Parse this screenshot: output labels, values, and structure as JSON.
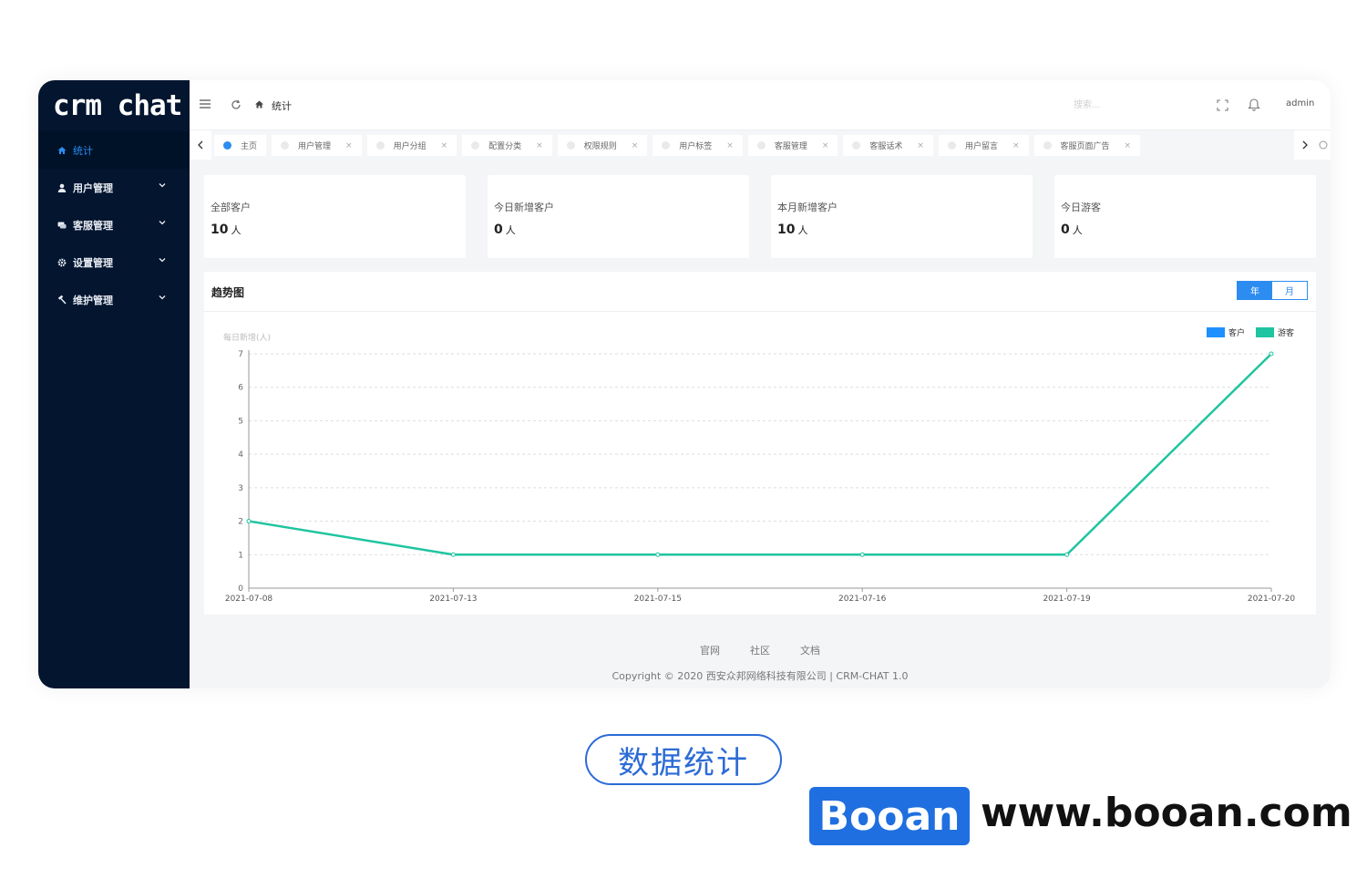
{
  "app": {
    "logo": "crm chat"
  },
  "sidebar": {
    "items": [
      {
        "label": "统计",
        "icon": "home-icon",
        "active": true
      },
      {
        "label": "用户管理",
        "icon": "user-icon"
      },
      {
        "label": "客服管理",
        "icon": "chat-icon"
      },
      {
        "label": "设置管理",
        "icon": "gear-icon"
      },
      {
        "label": "维护管理",
        "icon": "hammer-icon"
      }
    ]
  },
  "header": {
    "breadcrumb": "统计",
    "search_placeholder": "搜索...",
    "user": "admin"
  },
  "tabs": [
    {
      "label": "主页",
      "active": true
    },
    {
      "label": "用户管理"
    },
    {
      "label": "用户分组"
    },
    {
      "label": "配置分类"
    },
    {
      "label": "权限规则"
    },
    {
      "label": "用户标签"
    },
    {
      "label": "客服管理"
    },
    {
      "label": "客服话术"
    },
    {
      "label": "用户留言"
    },
    {
      "label": "客服页面广告"
    }
  ],
  "stats": [
    {
      "label": "全部客户",
      "value": "10",
      "unit": "人"
    },
    {
      "label": "今日新增客户",
      "value": "0",
      "unit": "人"
    },
    {
      "label": "本月新增客户",
      "value": "10",
      "unit": "人"
    },
    {
      "label": "今日游客",
      "value": "0",
      "unit": "人"
    }
  ],
  "trend": {
    "title": "趋势图",
    "toggle": {
      "year": "年",
      "month": "月",
      "selected": "year"
    }
  },
  "chart_data": {
    "type": "line",
    "ylabel": "每日新增(人)",
    "ylim": [
      0,
      7
    ],
    "yticks": [
      "0",
      "1",
      "2",
      "3",
      "4",
      "5",
      "6",
      "7"
    ],
    "x": [
      "2021-07-08",
      "2021-07-13",
      "2021-07-15",
      "2021-07-16",
      "2021-07-19",
      "2021-07-20"
    ],
    "legend_position": "top-right",
    "grid": true,
    "series": [
      {
        "name": "客户",
        "color": "#1e90ff",
        "values": []
      },
      {
        "name": "游客",
        "color": "#1fc4a0",
        "values": [
          2,
          1,
          1,
          1,
          1,
          7
        ]
      }
    ]
  },
  "footer": {
    "links": [
      "官网",
      "社区",
      "文档"
    ],
    "copyright": "Copyright © 2020 西安众邦网络科技有限公司 | CRM-CHAT 1.0"
  },
  "caption": "数据统计",
  "brand": {
    "name": "Booan",
    "url": "www.booan.com"
  },
  "colors": {
    "sidebar": "#03152f",
    "accent": "#2d8cf0",
    "line": "#1fc4a0"
  }
}
